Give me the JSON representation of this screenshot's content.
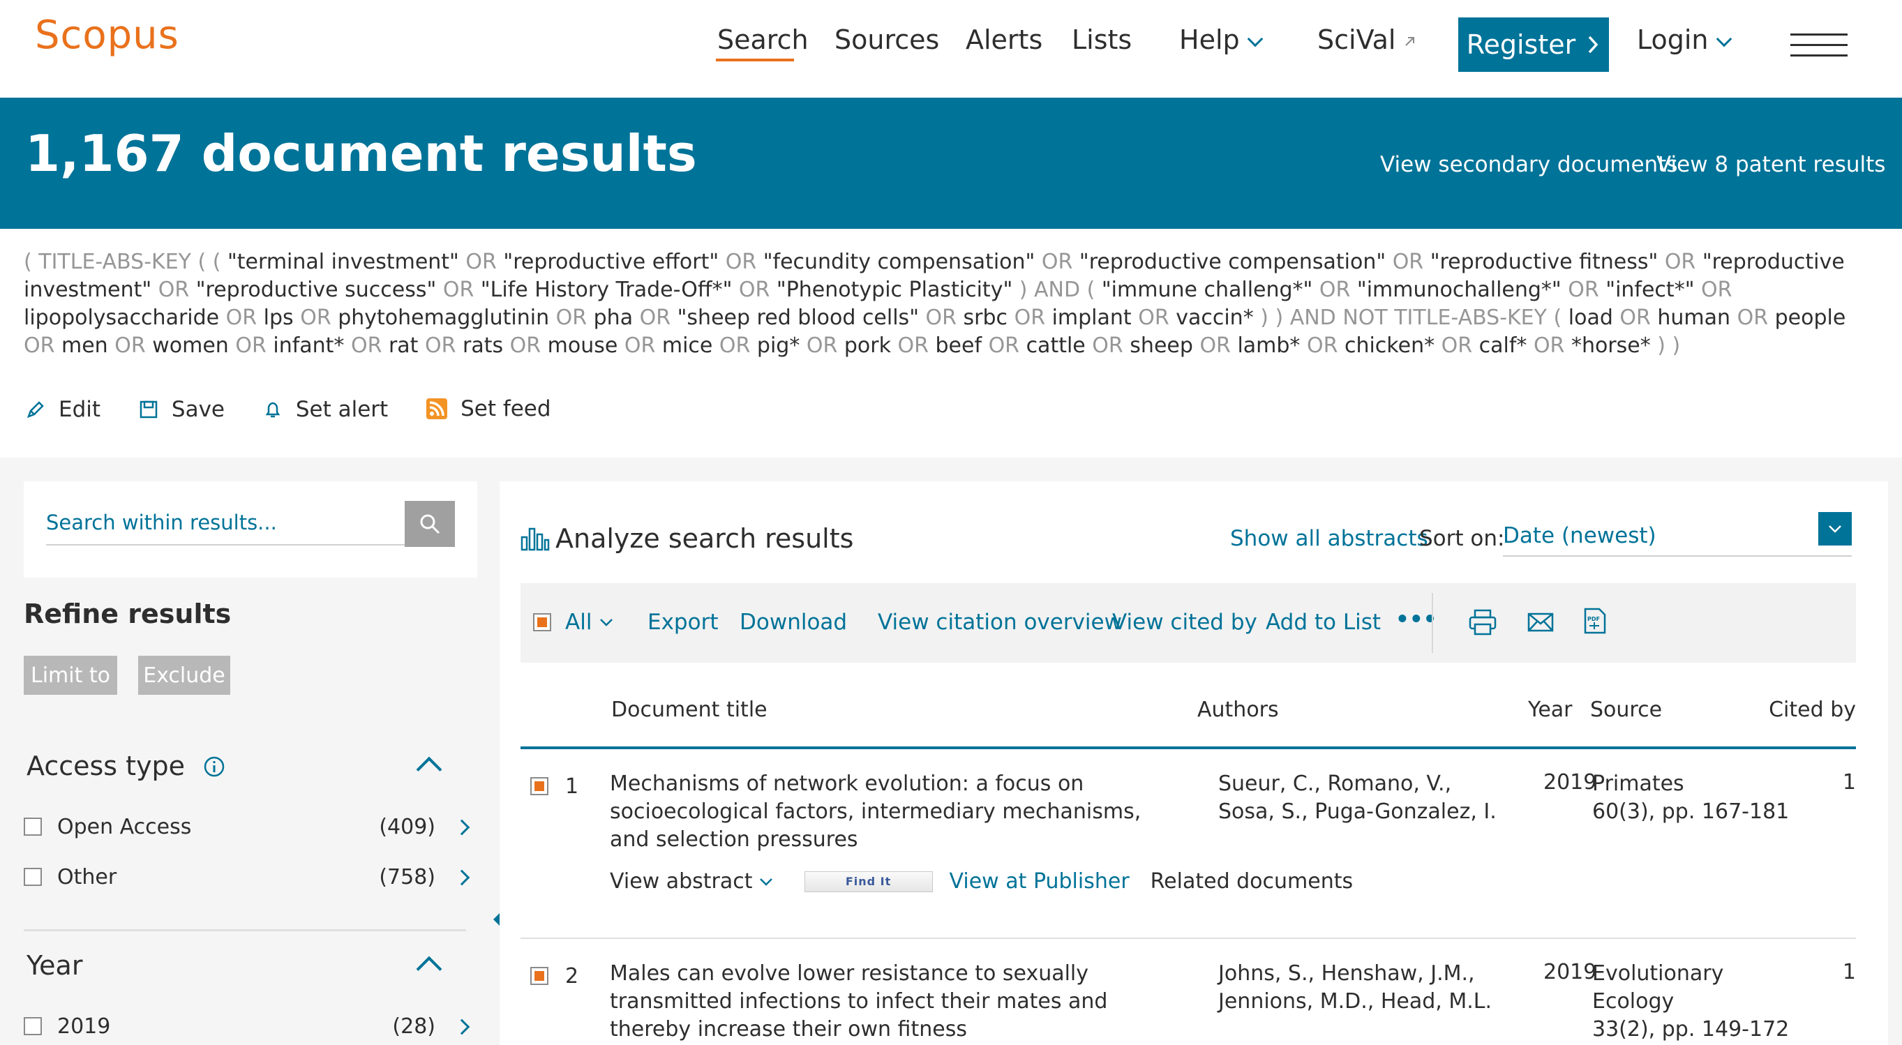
{
  "header": {
    "logo": "Scopus",
    "nav": [
      "Search",
      "Sources",
      "Alerts",
      "Lists",
      "Help",
      "SciVal"
    ],
    "register": "Register",
    "login": "Login"
  },
  "banner": {
    "title": "1,167 document results",
    "secondary_link": "View secondary documents",
    "patent_link": "View 8 patent results"
  },
  "query": {
    "t01": "( TITLE-ABS-KEY ( ( ",
    "t02": "\"terminal investment\"",
    "t03": " OR ",
    "t04": "\"reproductive effort\"",
    "t05": " OR ",
    "t06": "\"fecundity compensation\"",
    "t07": " OR ",
    "t08": "\"reproductive compensation\"",
    "t09": " OR ",
    "t10": "\"reproductive fitness\"",
    "t11": " OR ",
    "t12": "\"reproductive investment\"",
    "t13": " OR ",
    "t14": "\"reproductive success\"",
    "t15": " OR ",
    "t16": "\"Life History Trade-Off*\"",
    "t17": " OR ",
    "t18": "\"Phenotypic Plasticity\"",
    "t19": " ) AND ( ",
    "t20": "\"immune challeng*\"",
    "t21": " OR ",
    "t22": "\"immunochalleng*\"",
    "t23": " OR ",
    "t24": "\"infect*\"",
    "t25": " OR ",
    "t26": "lipopolysaccharide",
    "t27": " OR ",
    "t28": "lps",
    "t29": " OR ",
    "t30": "phytohemagglutinin",
    "t31": " OR ",
    "t32": "pha",
    "t33": " OR ",
    "t34": "\"sheep red blood cells\"",
    "t35": " OR ",
    "t36": "srbc",
    "t37": " OR ",
    "t38": "implant",
    "t39": " OR ",
    "t40": "vaccin*",
    "t41": " ) ) AND NOT TITLE-ABS-KEY ( ",
    "t42": "load",
    "t43": " OR ",
    "t44": "human",
    "t45": " OR ",
    "t46": "people",
    "t47": " OR ",
    "t48": "men",
    "t49": " OR ",
    "t50": "women",
    "t51": " OR ",
    "t52": "infant*",
    "t53": " OR ",
    "t54": "rat",
    "t55": " OR ",
    "t56": "rats",
    "t57": " OR ",
    "t58": "mouse",
    "t59": " OR ",
    "t60": "mice",
    "t61": " OR ",
    "t62": "pig*",
    "t63": " OR ",
    "t64": "pork",
    "t65": " OR ",
    "t66": "beef",
    "t67": " OR ",
    "t68": "cattle",
    "t69": " OR ",
    "t70": "sheep",
    "t71": " OR ",
    "t72": "lamb*",
    "t73": " OR ",
    "t74": "chicken*",
    "t75": " OR ",
    "t76": "calf*",
    "t77": " OR ",
    "t78": "*horse*",
    "t79": " ) )"
  },
  "query_actions": [
    "Edit",
    "Save",
    "Set alert",
    "Set feed"
  ],
  "sidebar": {
    "search_placeholder": "Search within results...",
    "refine_title": "Refine results",
    "limit_to": "Limit to",
    "exclude": "Exclude",
    "access": {
      "title": "Access type",
      "items": [
        {
          "label": "Open Access",
          "count": "(409)"
        },
        {
          "label": "Other",
          "count": "(758)"
        }
      ]
    },
    "year": {
      "title": "Year",
      "items": [
        {
          "label": "2019",
          "count": "(28)"
        }
      ]
    }
  },
  "results": {
    "analyze": "Analyze search results",
    "show_abstracts": "Show all abstracts",
    "sort_label": "Sort on:",
    "sort_value": "Date (newest)",
    "toolbar": {
      "all": "All",
      "export": "Export",
      "download": "Download",
      "citation_overview": "View citation overview",
      "cited_by": "View cited by",
      "add_to_list": "Add to List",
      "more": "•••"
    },
    "columns": [
      "Document title",
      "Authors",
      "Year",
      "Source",
      "Cited by"
    ],
    "rows": [
      {
        "num": "1",
        "title": "Mechanisms of network evolution: a focus on socioecological factors, intermediary mechanisms, and selection pressures",
        "authors": "Sueur, C., Romano, V., Sosa, S., Puga-Gonzalez, I.",
        "year": "2019",
        "source_name": "Primates",
        "source_detail": "60(3), pp. 167-181",
        "cited": "1",
        "view_abstract": "View abstract",
        "find_it": "Find It",
        "publisher": "View at Publisher",
        "related": "Related documents"
      },
      {
        "num": "2",
        "title": "Males can evolve lower resistance to sexually transmitted infections to infect their mates and thereby increase their own fitness",
        "authors": "Johns, S., Henshaw, J.M., Jennions, M.D., Head, M.L.",
        "year": "2019",
        "source_name": "Evolutionary Ecology",
        "source_detail": "33(2), pp. 149-172",
        "cited": "1"
      }
    ]
  },
  "colors": {
    "brand_orange": "#e9711c",
    "brand_blue": "#007398",
    "operator_grey": "#969696"
  }
}
